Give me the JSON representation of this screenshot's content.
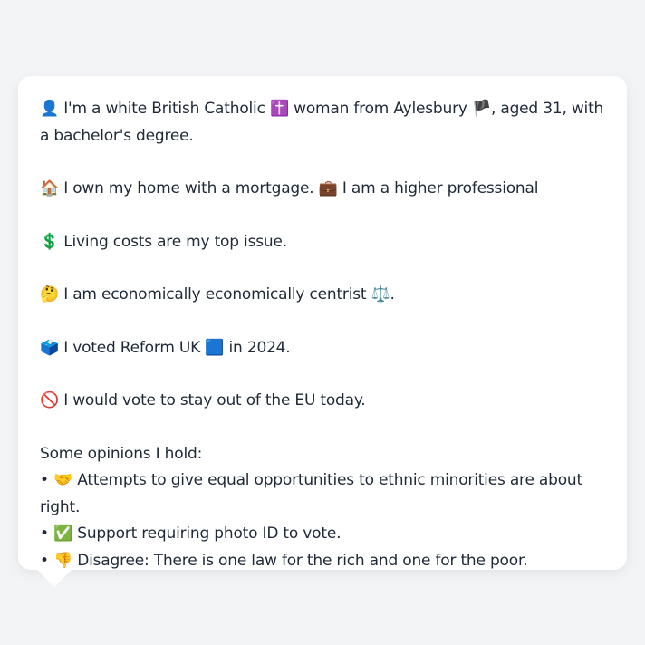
{
  "profile": {
    "identity": {
      "icon": "👤",
      "icon_name": "person-silhouette-icon",
      "text_before": "I'm a white British Catholic",
      "religion_icon": "✝️",
      "text_middle": "woman from Aylesbury",
      "flag_icon": "🏴",
      "text_after": ", aged 31, with a bachelor's degree."
    },
    "home": {
      "icon": "🏠",
      "icon_name": "house-icon",
      "text": "I own my home with a mortgage.",
      "work_icon": "💼",
      "work_text": "I am a higher professional"
    },
    "issue": {
      "icon": "💲",
      "icon_name": "dollar-sign-icon",
      "text": "Living costs are my top issue."
    },
    "economics": {
      "icon": "🤔",
      "icon_name": "thinking-face-icon",
      "text": "I am economically economically centrist",
      "scale_icon": "⚖️",
      "trail": "."
    },
    "vote": {
      "icon": "🗳️",
      "icon_name": "ballot-box-icon",
      "text_before": "I voted Reform UK",
      "party_icon": "🟦",
      "text_after": "in 2024."
    },
    "eu": {
      "icon": "🚫",
      "icon_name": "prohibited-icon",
      "text": "I would vote to stay out of the EU today."
    },
    "opinions": {
      "heading": "Some opinions I hold:",
      "bullet": "•",
      "items": [
        {
          "icon": "🤝",
          "icon_name": "handshake-icon",
          "text": "Attempts to give equal opportunities to ethnic minorities are about right."
        },
        {
          "icon": "✅",
          "icon_name": "check-mark-icon",
          "text": "Support requiring photo ID to vote."
        },
        {
          "icon": "👎",
          "icon_name": "thumbs-down-icon",
          "text": "Disagree: There is one law for the rich and one for the poor."
        }
      ]
    }
  }
}
